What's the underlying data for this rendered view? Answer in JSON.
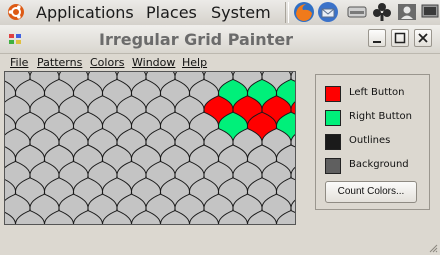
{
  "panel": {
    "menus": [
      "Applications",
      "Places",
      "System"
    ],
    "launchers": [
      "firefox-icon",
      "thunderbird-icon"
    ],
    "applets": [
      "hard-disk-icon",
      "card-game-icon",
      "user-icon"
    ]
  },
  "window": {
    "title": "Irregular Grid Painter",
    "menubar": [
      "File",
      "Patterns",
      "Colors",
      "Window",
      "Help"
    ]
  },
  "palette": {
    "items": [
      {
        "label": "Left Button",
        "color": "#ff0000"
      },
      {
        "label": "Right Button",
        "color": "#00f07a"
      },
      {
        "label": "Outlines",
        "color": "#1a1a1a"
      },
      {
        "label": "Background",
        "color": "#5f5f5f"
      }
    ],
    "count_button": "Count Colors..."
  },
  "grid": {
    "tile_fill": "#c4c4c4",
    "outline": "#1a1a1a",
    "red": "#ff0000",
    "green": "#00f07a",
    "red_cells": [
      [
        7,
        2
      ],
      [
        8,
        2
      ],
      [
        9,
        2
      ],
      [
        10,
        2
      ],
      [
        11,
        2
      ],
      [
        8,
        3
      ],
      [
        10,
        3
      ]
    ],
    "green_cells": [
      [
        7,
        1
      ],
      [
        8,
        1
      ],
      [
        9,
        1
      ],
      [
        10,
        1
      ],
      [
        8,
        2
      ],
      [
        9,
        3
      ],
      [
        10,
        3
      ],
      [
        11,
        3
      ],
      [
        7,
        3
      ]
    ]
  }
}
